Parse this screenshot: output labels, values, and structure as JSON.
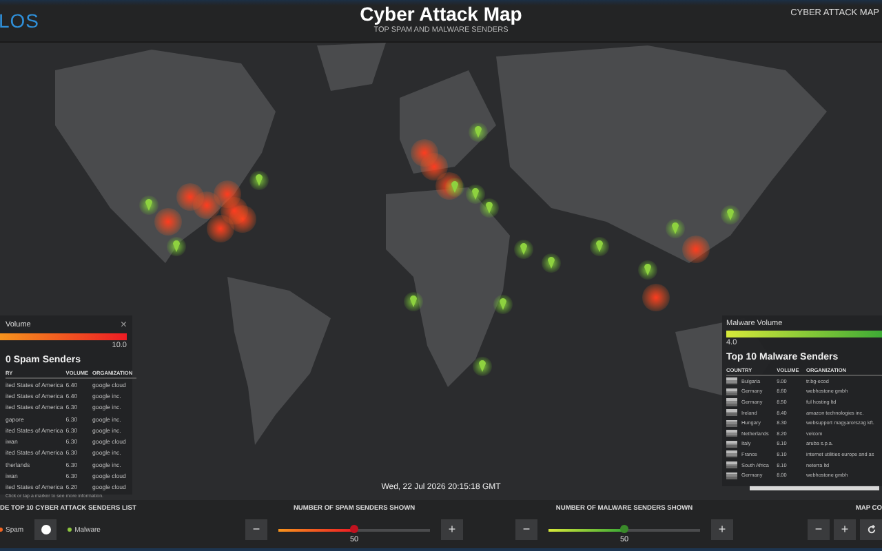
{
  "header": {
    "logo": "LOS",
    "title": "Cyber Attack Map",
    "subtitle": "TOP SPAM AND MALWARE SENDERS",
    "nav_link": "CYBER ATTACK MAP"
  },
  "map": {
    "timestamp": "Wed, 22 Jul 2026 20:15:18 GMT",
    "hint": "Click or tap a marker to see more information."
  },
  "spam_panel": {
    "legend_title": "Volume",
    "close": "×",
    "legend_value": "10.0",
    "title": "0 Spam Senders",
    "columns": [
      "RY",
      "VOLUME",
      "ORGANIZATION"
    ],
    "rows": [
      {
        "country": "ited States of America",
        "volume": "6.40",
        "organization": "google cloud"
      },
      {
        "country": "ited States of America",
        "volume": "6.40",
        "organization": "google inc."
      },
      {
        "country": "ited States of America",
        "volume": "6.30",
        "organization": "google inc."
      },
      {
        "country": "gapore",
        "volume": "6.30",
        "organization": "google inc."
      },
      {
        "country": "ited States of America",
        "volume": "6.30",
        "organization": "google inc."
      },
      {
        "country": "iwan",
        "volume": "6.30",
        "organization": "google cloud"
      },
      {
        "country": "ited States of America",
        "volume": "6.30",
        "organization": "google inc."
      },
      {
        "country": "therlands",
        "volume": "6.30",
        "organization": "google inc."
      },
      {
        "country": "iwan",
        "volume": "6.30",
        "organization": "google cloud"
      },
      {
        "country": "ited States of America",
        "volume": "6.20",
        "organization": "google cloud"
      }
    ]
  },
  "malware_panel": {
    "legend_title": "Malware Volume",
    "legend_value": "4.0",
    "title": "Top 10 Malware Senders",
    "columns": [
      "COUNTRY",
      "VOLUME",
      "ORGANIZATION"
    ],
    "rows": [
      {
        "country": "Bulgaria",
        "volume": "9.00",
        "organization": "tr.bg-ecod"
      },
      {
        "country": "Germany",
        "volume": "8.60",
        "organization": "webhostone gmbh"
      },
      {
        "country": "Germany",
        "volume": "8.50",
        "organization": "ful hosting ltd"
      },
      {
        "country": "Ireland",
        "volume": "8.40",
        "organization": "amazon technologies inc."
      },
      {
        "country": "Hungary",
        "volume": "8.30",
        "organization": "websupport magyarorszag kft."
      },
      {
        "country": "Netherlands",
        "volume": "8.20",
        "organization": "velcom"
      },
      {
        "country": "Italy",
        "volume": "8.10",
        "organization": "aruba s.p.a."
      },
      {
        "country": "France",
        "volume": "8.10",
        "organization": "internet utilities europe and as"
      },
      {
        "country": "South Africa",
        "volume": "8.10",
        "organization": "neterra ltd"
      },
      {
        "country": "Germany",
        "volume": "8.00",
        "organization": "webhostone gmbh"
      }
    ]
  },
  "controls": {
    "toggle_label": "DE TOP 10 CYBER ATTACK SENDERS LIST",
    "options": [
      {
        "label": "Spam",
        "color": "#f26522"
      },
      {
        "label": "Malware",
        "color": "#8dc63f"
      }
    ],
    "sliders": [
      {
        "kind": "spam",
        "label": "NUMBER OF SPAM SENDERS SHOWN",
        "minus": "−",
        "plus": "+",
        "level": 0.5,
        "value": "50"
      },
      {
        "kind": "malware",
        "label": "NUMBER OF MALWARE SENDERS SHOWN",
        "minus": "−",
        "plus": "+",
        "level": 0.5,
        "value": "50"
      }
    ],
    "map_controls": {
      "label": "MAP CO",
      "zoom_out": "−",
      "zoom_in": "+"
    }
  }
}
